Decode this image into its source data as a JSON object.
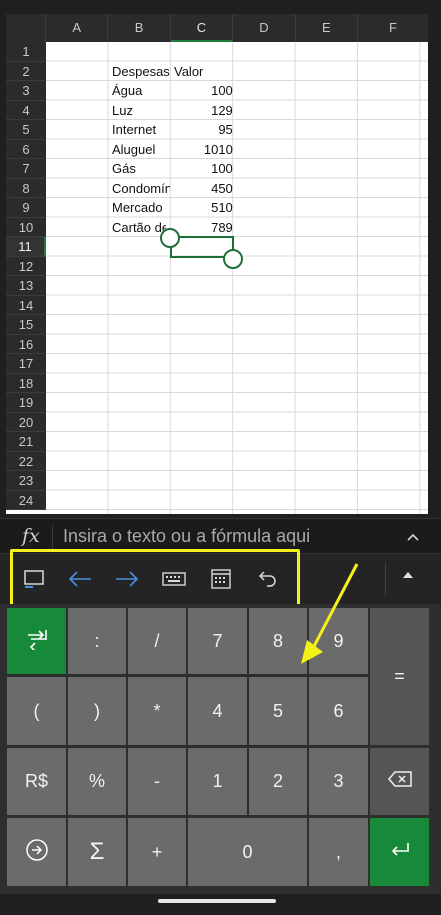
{
  "columns": [
    "A",
    "B",
    "C",
    "D",
    "E",
    "F"
  ],
  "selected_column": "C",
  "rows": [
    "1",
    "2",
    "3",
    "4",
    "5",
    "6",
    "7",
    "8",
    "9",
    "10",
    "11",
    "12",
    "13",
    "14",
    "15",
    "16",
    "17",
    "18",
    "19",
    "20",
    "21",
    "22",
    "23",
    "24"
  ],
  "selected_row": "11",
  "cells": {
    "B2": "Despesas",
    "C2": "Valor",
    "B3": "Água",
    "C3": "100",
    "B4": "Luz",
    "C4": "129",
    "B5": "Internet",
    "C5": "95",
    "B6": "Aluguel",
    "C6": "1010",
    "B7": "Gás",
    "C7": "100",
    "B8": "Condomín",
    "C8": "450",
    "B9": "Mercado",
    "C9": "510",
    "B10": "Cartão de",
    "C10": "789"
  },
  "formula_bar": {
    "fx_label": "fx",
    "placeholder": "Insira o texto ou a fórmula aqui"
  },
  "toolbar": {
    "icons": [
      "sheet-view-icon",
      "arrow-left-icon",
      "arrow-right-icon",
      "keyboard-icon",
      "calendar-icon",
      "undo-icon"
    ],
    "highlight_color": "#f4f118"
  },
  "keypad": {
    "row1": [
      "tab-key-icon",
      ":",
      "/",
      "7",
      "8",
      "9"
    ],
    "row2": [
      "(",
      ")",
      "*",
      "4",
      "5",
      "6"
    ],
    "row3": [
      "R$",
      "%",
      "-",
      "1",
      "2",
      "3"
    ],
    "row4": [
      "circle-arrow-icon",
      "Σ",
      "+",
      "0",
      ","
    ],
    "equals": "=",
    "backspace": "backspace-icon",
    "enter": "enter-icon"
  },
  "colors": {
    "accent_green": "#178a3a",
    "annotation_yellow": "#f4f118"
  }
}
